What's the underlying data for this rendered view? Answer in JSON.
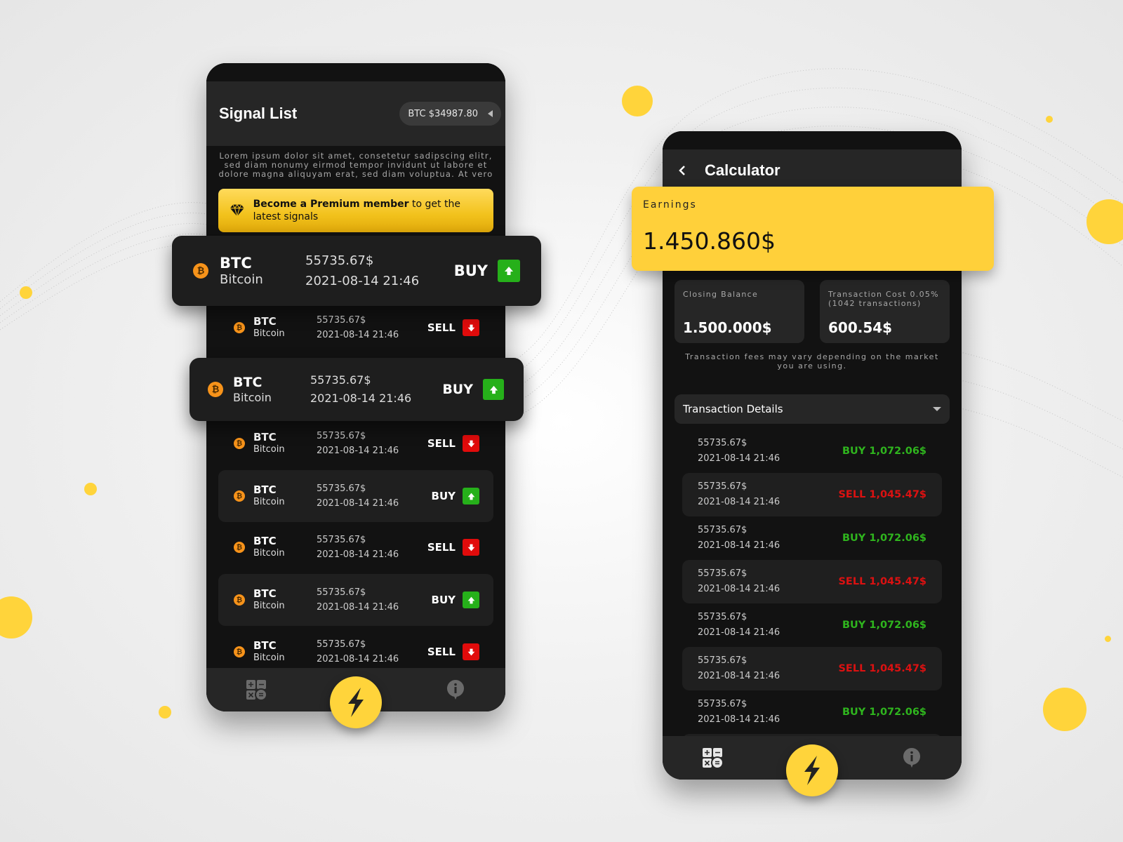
{
  "colors": {
    "accent": "#ffd43b",
    "buy": "#26b01a",
    "sell": "#e10b0b",
    "card": "#1f1f1f",
    "bg": "#121212"
  },
  "signal_list": {
    "title": "Signal List",
    "btc_price": "BTC $34987.80",
    "description": "Lorem ipsum dolor sit amet, consetetur sadipscing elitr, sed diam nonumy eirmod tempor invidunt ut labore et dolore magna aliquyam erat, sed diam voluptua. At vero",
    "premium": {
      "bold": "Become a Premium member",
      "rest": " to get the latest signals",
      "icon": "diamond-icon"
    },
    "featured": [
      {
        "symbol": "BTC",
        "name": "Bitcoin",
        "price": "55735.67$",
        "time": "2021-08-14 21:46",
        "action": "BUY"
      },
      {
        "symbol": "BTC",
        "name": "Bitcoin",
        "price": "55735.67$",
        "time": "2021-08-14 21:46",
        "action": "BUY"
      }
    ],
    "signals": [
      {
        "symbol": "BTC",
        "name": "Bitcoin",
        "price": "55735.67$",
        "time": "2021-08-14 21:46",
        "action": "SELL"
      },
      {
        "symbol": "BTC",
        "name": "Bitcoin",
        "price": "55735.67$",
        "time": "2021-08-14 21:46",
        "action": "SELL"
      },
      {
        "symbol": "BTC",
        "name": "Bitcoin",
        "price": "55735.67$",
        "time": "2021-08-14 21:46",
        "action": "BUY"
      },
      {
        "symbol": "BTC",
        "name": "Bitcoin",
        "price": "55735.67$",
        "time": "2021-08-14 21:46",
        "action": "SELL"
      },
      {
        "symbol": "BTC",
        "name": "Bitcoin",
        "price": "55735.67$",
        "time": "2021-08-14 21:46",
        "action": "BUY"
      },
      {
        "symbol": "BTC",
        "name": "Bitcoin",
        "price": "55735.67$",
        "time": "2021-08-14 21:46",
        "action": "SELL"
      }
    ]
  },
  "calculator": {
    "title": "Calculator",
    "earnings_label": "Earnings",
    "earnings_value": "1.450.860$",
    "closing_balance_label": "Closing Balance",
    "closing_balance_value": "1.500.000$",
    "transaction_cost_label": "Transaction Cost 0.05% (1042 transactions)",
    "transaction_cost_value": "600.54$",
    "fee_note": "Transaction fees may vary depending on the market you are using.",
    "details_label": "Transaction Details",
    "transactions": [
      {
        "price": "55735.67$",
        "time": "2021-08-14 21:46",
        "amount": "BUY 1,072.06$",
        "type": "buy"
      },
      {
        "price": "55735.67$",
        "time": "2021-08-14 21:46",
        "amount": "SELL 1,045.47$",
        "type": "sell"
      },
      {
        "price": "55735.67$",
        "time": "2021-08-14 21:46",
        "amount": "BUY 1,072.06$",
        "type": "buy"
      },
      {
        "price": "55735.67$",
        "time": "2021-08-14 21:46",
        "amount": "SELL 1,045.47$",
        "type": "sell"
      },
      {
        "price": "55735.67$",
        "time": "2021-08-14 21:46",
        "amount": "BUY 1,072.06$",
        "type": "buy"
      },
      {
        "price": "55735.67$",
        "time": "2021-08-14 21:46",
        "amount": "SELL 1,045.47$",
        "type": "sell"
      },
      {
        "price": "55735.67$",
        "time": "2021-08-14 21:46",
        "amount": "BUY 1,072.06$",
        "type": "buy"
      }
    ]
  },
  "nav": {
    "items": [
      "calculator-icon",
      "lightning-icon",
      "info-icon"
    ]
  }
}
